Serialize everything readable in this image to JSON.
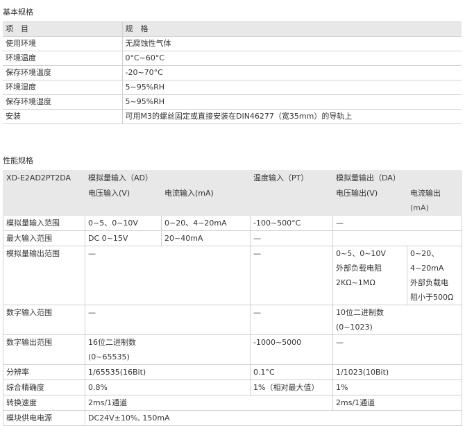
{
  "basic": {
    "title": "基本规格",
    "header": [
      "项　目",
      "规　格"
    ],
    "rows": [
      [
        "使用环境",
        "无腐蚀性气体"
      ],
      [
        "环境温度",
        "0°C~60°C"
      ],
      [
        "保存环境温度",
        "-20~70°C"
      ],
      [
        "环境湿度",
        "5~95%RH"
      ],
      [
        "保存环境湿度",
        "5~95%RH"
      ],
      [
        "安装",
        "可用M3的螺丝固定或直接安装在DIN46277（宽35mm）的导轨上"
      ]
    ]
  },
  "perf": {
    "title": "性能规格",
    "model": "XD-E2AD2PT2DA",
    "ad_in": "模拟量输入（AD）",
    "pt_in": "温度输入（PT）",
    "da_out": "模拟量输出（DA）",
    "v_in": "电压输入(V)",
    "i_in": "电流输入(mA)",
    "v_out": "电压输出(V)",
    "i_out_1": "电流输出",
    "i_out_2": "(mA)",
    "r1": {
      "label": "模拟量输入范围",
      "v": "0~5、0~10V",
      "i": "0~20、4~20mA",
      "pt": "-100~500°C",
      "da": "—"
    },
    "r2": {
      "label": "最大输入范围",
      "v": "DC 0~15V",
      "i": "20~40mA",
      "pt": "—"
    },
    "r3": {
      "label": "模拟量输出范围",
      "ad": "—",
      "pt": "—",
      "v1": "0~5、0~10V",
      "v2": "外部负载电阻",
      "v3": "2KΩ~1MΩ",
      "i1": "0~20、",
      "i2": "4~20mA",
      "i3": "外部负载电",
      "i4": "阻小于500Ω"
    },
    "r4": {
      "label": "数字输入范围",
      "ad": "—",
      "pt": "—",
      "da1": "10位二进制数",
      "da2": "(0~1023)"
    },
    "r5": {
      "label": "数字输出范围",
      "ad1": "16位二进制数",
      "ad2": "(0~65535)",
      "pt": "-1000~5000",
      "da": "—"
    },
    "r6": {
      "label": "分辨率",
      "ad": "1/65535(16Bit)",
      "pt": "0.1°C",
      "da": "1/1023(10Bit)"
    },
    "r7": {
      "label": "综合精确度",
      "ad": "0.8%",
      "pt": "1%（相对最大值）",
      "da": "1%"
    },
    "r8": {
      "label": "转换速度",
      "ad": "2ms/1通道",
      "da": "2ms/1通道"
    },
    "r9": {
      "label": "模块供电电源",
      "val": "DC24V±10%, 150mA"
    }
  }
}
